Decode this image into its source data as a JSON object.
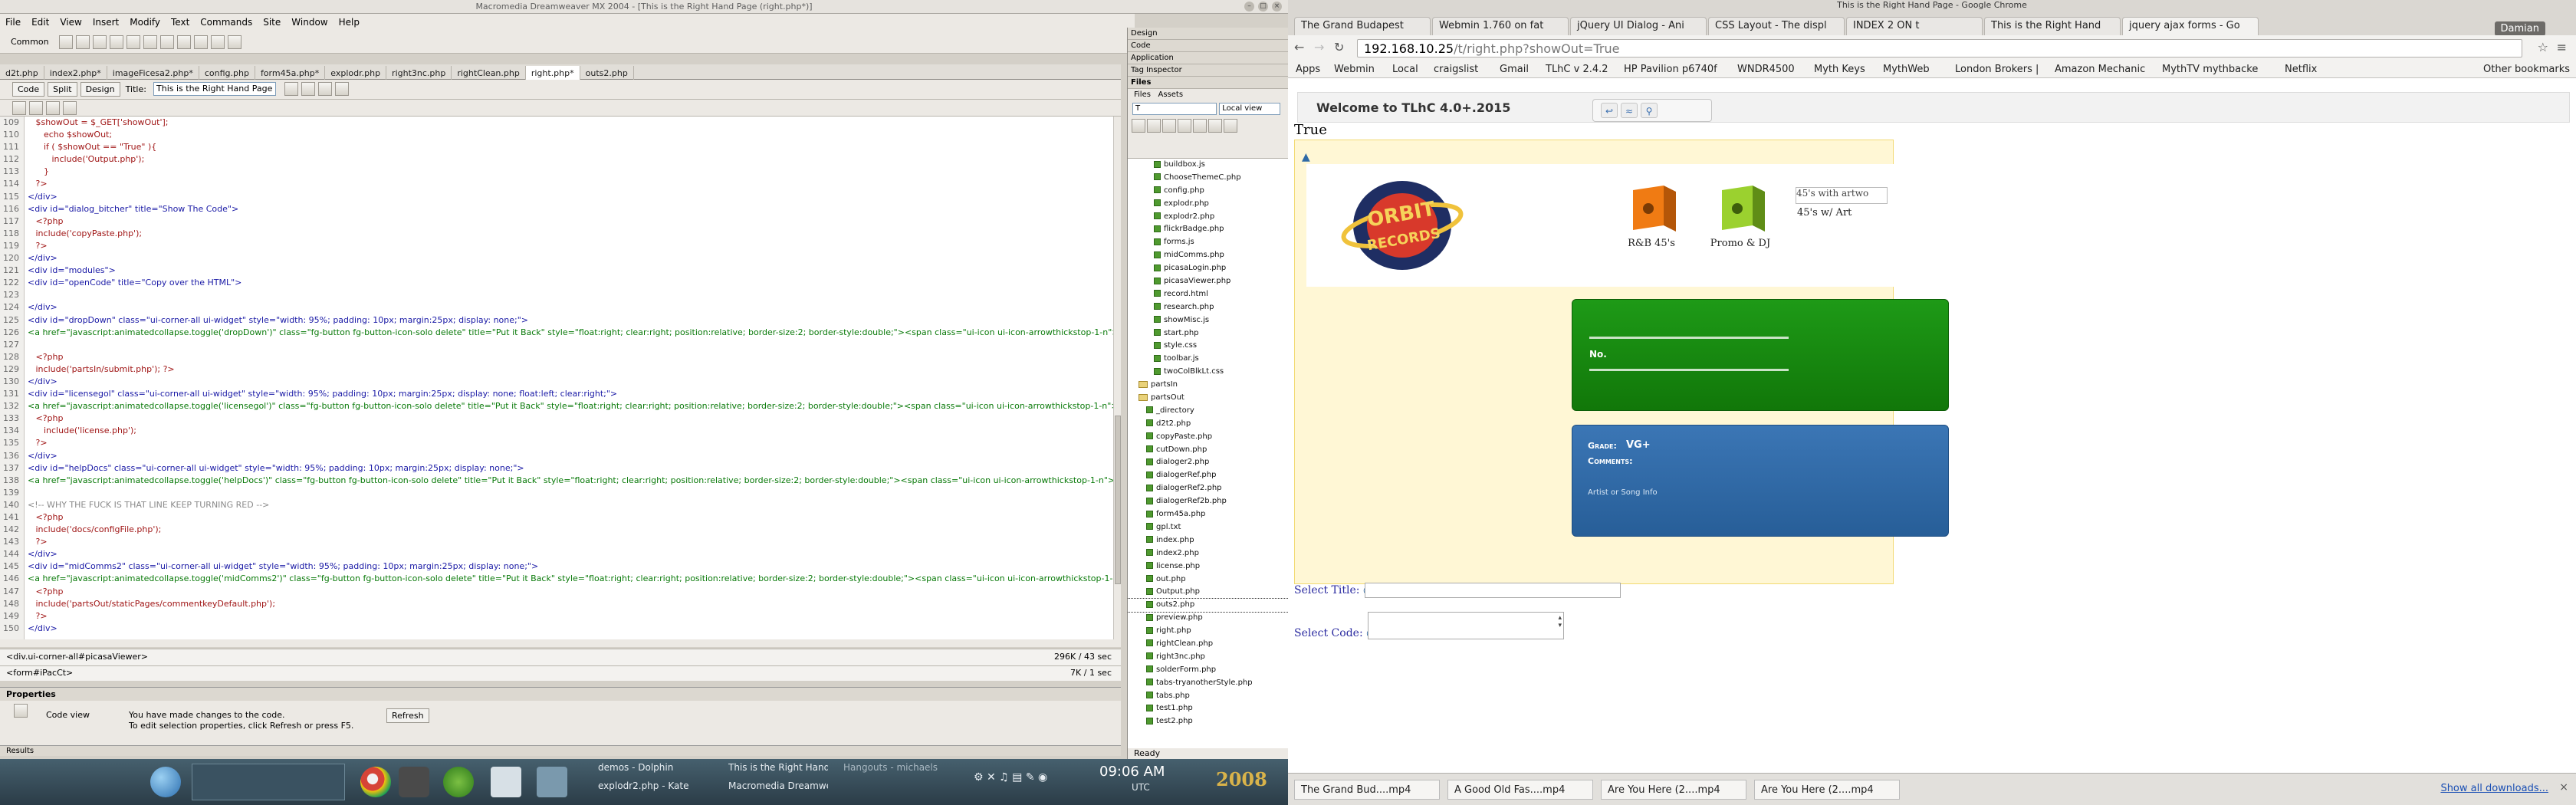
{
  "dreamweaver": {
    "window_title": "Macromedia Dreamweaver MX 2004 - [This is the Right Hand Page (right.php*)]",
    "menu": [
      "File",
      "Edit",
      "View",
      "Insert",
      "Modify",
      "Text",
      "Commands",
      "Site",
      "Window",
      "Help"
    ],
    "insert_category": "Common",
    "doc_tabs": [
      "d2t.php",
      "index2.php*",
      "imageFicesa2.php*",
      "config.php",
      "form45a.php*",
      "explodr.php",
      "right3nc.php",
      "rightClean.php",
      "right.php*",
      "outs2.php"
    ],
    "active_tab": "right.php*",
    "view_buttons": {
      "code": "Code",
      "split": "Split",
      "design": "Design"
    },
    "title_label": "Title:",
    "title_value": "This is the Right Hand Page",
    "line_numbers": [
      "109",
      "110",
      "111",
      "112",
      "113",
      "114",
      "115",
      "116",
      "117",
      "118",
      "119",
      "120",
      "121",
      "122",
      "123",
      "124",
      "125",
      "126",
      "127",
      "128",
      "129",
      "130",
      "131",
      "132",
      "133",
      "134",
      "135",
      "136",
      "137",
      "138",
      "139",
      "140",
      "141",
      "142",
      "143",
      "144",
      "145",
      "146",
      "147",
      "148",
      "149",
      "150"
    ],
    "code_lines": [
      "   $showOut = $_GET['showOut'];",
      "      echo $showOut;",
      "      if ( $showOut == \"True\" ){",
      "         include('Output.php');",
      "      }",
      "   ?>",
      "</div>",
      "<div id=\"dialog_bitcher\" title=\"Show The Code\">",
      "   <?php",
      "   include('copyPaste.php');",
      "   ?>",
      "</div>",
      "<div id=\"modules\">",
      "<div id=\"openCode\" title=\"Copy over the HTML\">",
      "",
      "</div>",
      "<div id=\"dropDown\" class=\"ui-corner-all ui-widget\" style=\"width: 95%; padding: 10px; margin:25px; display: none;\">",
      "<a href=\"javascript:animatedcollapse.toggle('dropDown')\" class=\"fg-button fg-button-icon-solo delete\" title=\"Put it Back\" style=\"float:right; clear:right; position:relative; border-size:2; border-style:double;\"><span class=\"ui-icon ui-icon-arrowthickstop-1-n\"></span></a>",
      "",
      "   <?php",
      "   include('partsIn/submit.php'); ?>",
      "</div>",
      "<div id=\"licensegol\" class=\"ui-corner-all ui-widget\" style=\"width: 95%; padding: 10px; margin:25px; display: none; float:left; clear:right;\">",
      "<a href=\"javascript:animatedcollapse.toggle('licensegol')\" class=\"fg-button fg-button-icon-solo delete\" title=\"Put it Back\" style=\"float:right; clear:right; position:relative; border-size:2; border-style:double;\"><span class=\"ui-icon ui-icon-arrowthickstop-1-n\"></span></a>",
      "   <?php",
      "      include('license.php');",
      "   ?>",
      "</div>",
      "<div id=\"helpDocs\" class=\"ui-corner-all ui-widget\" style=\"width: 95%; padding: 10px; margin:25px; display: none;\">",
      "<a href=\"javascript:animatedcollapse.toggle('helpDocs')\" class=\"fg-button fg-button-icon-solo delete\" title=\"Put it Back\" style=\"float:right; clear:right; position:relative; border-size:2; border-style:double;\"><span class=\"ui-icon ui-icon-arrowthickstop-1-n\"></span></a>",
      "",
      "<!-- WHY THE FUCK IS THAT LINE KEEP TURNING RED -->",
      "   <?php",
      "   include('docs/configFile.php');",
      "   ?>",
      "</div>",
      "<div id=\"midComms2\" class=\"ui-corner-all ui-widget\" style=\"width: 95%; padding: 10px; margin:25px; display: none;\">",
      "<a href=\"javascript:animatedcollapse.toggle('midComms2')\" class=\"fg-button fg-button-icon-solo delete\" title=\"Put it Back\" style=\"float:right; clear:right; position:relative; border-size:2; border-style:double;\"><span class=\"ui-icon ui-icon-arrowthickstop-1-n\"></span></a>",
      "   <?php",
      "   include('partsOut/staticPages/commentkeyDefault.php');",
      "   ?>",
      "</div>"
    ],
    "tag_selector": "<div.ui-corner-all#picasaViewer>",
    "tag_selector2": "<form#iPacCt>",
    "doc_size": "296K / 43 sec",
    "doc_size2": "7K / 1 sec",
    "properties_title": "Properties",
    "code_view_label": "Code view",
    "props_msg1": "You have made changes to the code.",
    "props_msg2": "To edit selection properties, click Refresh or press F5.",
    "refresh_button": "Refresh",
    "results_title": "Results",
    "panel_groups": [
      "Design",
      "Code",
      "Application",
      "Tag Inspector",
      "Files"
    ],
    "files_tabs": [
      "Files",
      "Assets"
    ],
    "site_select": "T",
    "view_select": "Local view",
    "files": [
      "buildbox.js",
      "ChooseThemeC.php",
      "config.php",
      "explodr.php",
      "explodr2.php",
      "flickrBadge.php",
      "forms.js",
      "midComms.php",
      "picasaLogin.php",
      "picasaViewer.php",
      "record.html",
      "research.php",
      "showMisc.js",
      "start.php",
      "style.css",
      "toolbar.js",
      "twoColBlkLt.css",
      "partsIn",
      "partsOut",
      "_directory",
      "d2t2.php",
      "copyPaste.php",
      "cutDown.php",
      "dialoger2.php",
      "dialogerRef.php",
      "dialogerRef2.php",
      "dialogerRef2b.php",
      "form45a.php",
      "gpl.txt",
      "index.php",
      "index2.php",
      "license.php",
      "out.php",
      "Output.php",
      "outs2.php",
      "preview.php",
      "right.php",
      "rightClean.php",
      "right3nc.php",
      "solderForm.php",
      "tabs-tryanotherStyle.php",
      "tabs.php",
      "test1.php",
      "test2.php"
    ],
    "ready": "Ready"
  },
  "taskbar": {
    "windows": [
      "demos - Dolphin",
      "explodr2.php - Kate",
      "This is the Right Hand Page",
      "Macromedia Dreamweaver",
      "Hangouts - michaels"
    ],
    "clock": "09:06 AM",
    "timezone": "UTC",
    "year": "2008"
  },
  "chrome": {
    "window_title": "This is the Right Hand Page - Google Chrome",
    "tabs": [
      "The Grand Budapest",
      "Webmin 1.760 on fat",
      "jQuery UI Dialog - Ani",
      "CSS Layout - The displ",
      "INDEX 2 ON t",
      "This is the Right Hand",
      "jquery ajax forms - Go"
    ],
    "active_tab": "This is the Right Hand",
    "user": "Damian",
    "url_host": "192.168.10.25",
    "url_path": "/t/right.php?showOut=True",
    "bookmarks": [
      "Apps",
      "Webmin",
      "Local",
      "craigslist",
      "Gmail",
      "TLhC v 2.4.2",
      "HP Pavilion p6740f",
      "WNDR4500",
      "Myth Keys",
      "MythWeb",
      "London Brokers |",
      "Amazon Mechanic",
      "MythTV mythbacke",
      "Netflix",
      "Other bookmarks"
    ]
  },
  "page": {
    "welcome": "Welcome to TLhC 4.0+.2015",
    "showout_text": "True",
    "logo_text": "ORBIT RECORDS",
    "cards": [
      "R&B 45's",
      "Promo & DJ"
    ],
    "broken_image_alt": "45's with artwo",
    "card3_label": "45's w/ Art",
    "green_label": "No.",
    "grade_label": "Grade:",
    "grade_value": "VG+",
    "comments_label": "Comments:",
    "artist_text": "Artist or Song Info",
    "select_title_label": "Select Title:",
    "select_code_label": "Select Code:",
    "downloads": [
      "The Grand Bud....mp4",
      "A Good Old Fas....mp4",
      "Are You Here (2....mp4",
      "Are You Here (2....mp4"
    ],
    "show_all": "Show all downloads..."
  }
}
